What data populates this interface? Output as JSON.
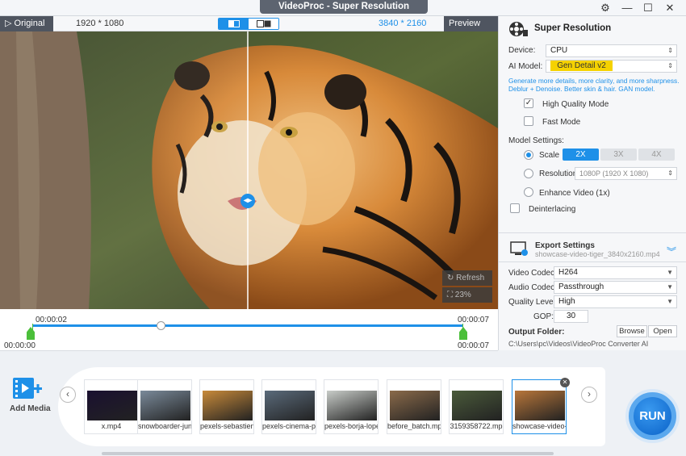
{
  "app": {
    "title": "VideoProc  -  Super Resolution"
  },
  "video_bar": {
    "original_label": "Original",
    "original_res": "1920 * 1080",
    "output_res": "3840 * 2160",
    "preview_label": "Preview"
  },
  "preview_overlay": {
    "refresh_label": "Refresh",
    "zoom_label": "23%"
  },
  "timeline": {
    "current": "00:00:02",
    "start": "00:00:00",
    "end_top": "00:00:07",
    "end_bottom": "00:00:07",
    "progress": 0.3
  },
  "panel": {
    "title": "Super Resolution",
    "device_label": "Device:",
    "device_value": "CPU",
    "ai_model_label": "AI Model:",
    "ai_model_value": "Gen Detail v2",
    "ai_desc": "Generate more details, more clarity, and more sharpness. Deblur + Denoise. Better skin & hair. GAN model.",
    "high_quality": "High Quality Mode",
    "high_quality_checked": true,
    "fast_mode": "Fast Mode",
    "model_settings": "Model Settings:",
    "scale_label": "Scale",
    "scale_options": [
      "2X",
      "3X",
      "4X"
    ],
    "resolution_label": "Resolution",
    "resolution_value": "1080P (1920 X 1080)",
    "enhance_label": "Enhance Video (1x)",
    "deinterlacing": "Deinterlacing"
  },
  "export": {
    "title": "Export Settings",
    "filename": "showcase-video-tiger_3840x2160.mp4",
    "video_codec_label": "Video Codec:",
    "video_codec": "H264",
    "audio_codec_label": "Audio Codec:",
    "audio_codec": "Passthrough",
    "quality_label": "Quality Level:",
    "quality": "High",
    "gop_label": "GOP:",
    "gop": "30",
    "output_folder_label": "Output Folder:",
    "browse": "Browse",
    "open": "Open",
    "path": "C:\\Users\\pc\\Videos\\VideoProc Converter AI"
  },
  "media": {
    "add_label": "Add Media",
    "items": [
      {
        "name": "x.mp4",
        "color": "#1a1030"
      },
      {
        "name": "snowboarder-jun",
        "color": "#7a8a9a"
      },
      {
        "name": "pexels-sebastien",
        "color": "#c88a3a"
      },
      {
        "name": "pexels-cinema-pr",
        "color": "#5a6a7a"
      },
      {
        "name": "pexels-borja-lope",
        "color": "#c8ccc8"
      },
      {
        "name": "before_batch.mp",
        "color": "#8a6a4a"
      },
      {
        "name": "3159358722.mp",
        "color": "#4a5a3a"
      },
      {
        "name": "showcase-video-",
        "color": "#b8763a"
      }
    ]
  },
  "run_label": "RUN"
}
